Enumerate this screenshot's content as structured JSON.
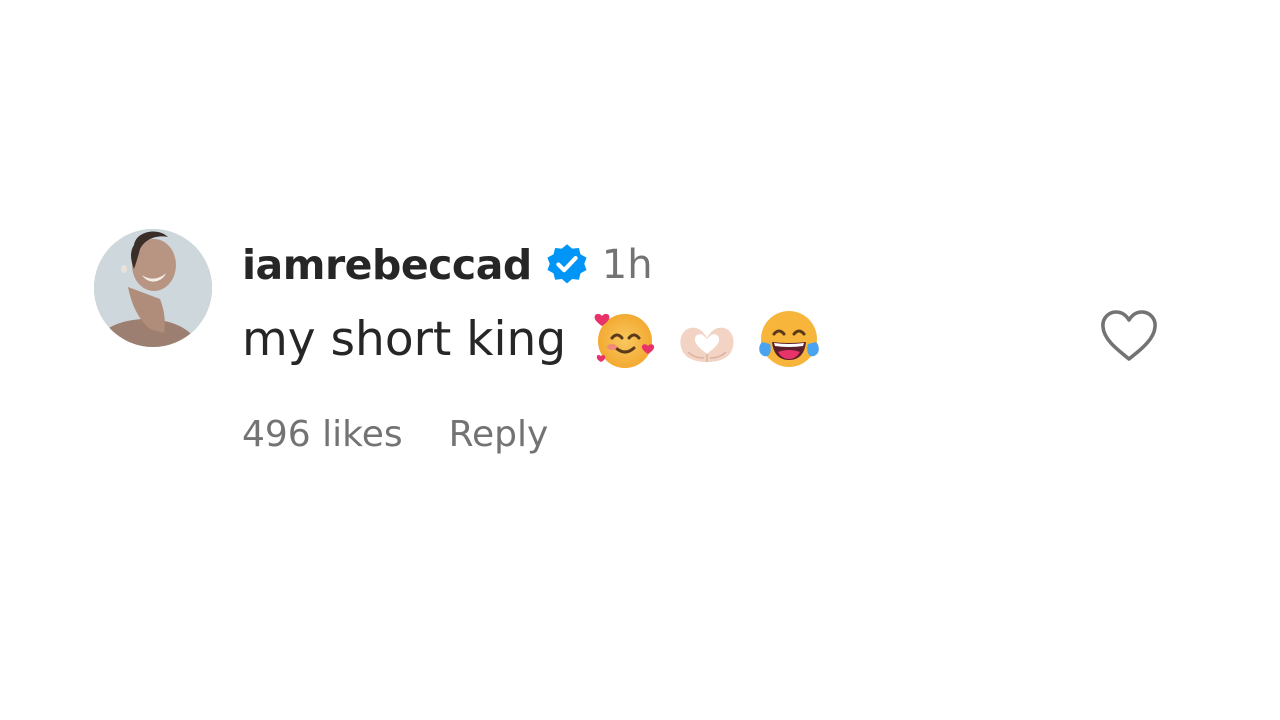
{
  "comment": {
    "username": "iamrebeccad",
    "verified": true,
    "timestamp": "1h",
    "text": "my short king",
    "emojis": [
      "smiling-face-with-hearts-icon",
      "heart-hands-icon",
      "face-with-tears-of-joy-icon"
    ],
    "likes_label": "496 likes",
    "reply_label": "Reply",
    "liked": false
  },
  "colors": {
    "text_primary": "#262626",
    "text_secondary": "#737373",
    "verified_blue": "#0095f6",
    "background": "#ffffff",
    "heart_outline": "#737373"
  }
}
